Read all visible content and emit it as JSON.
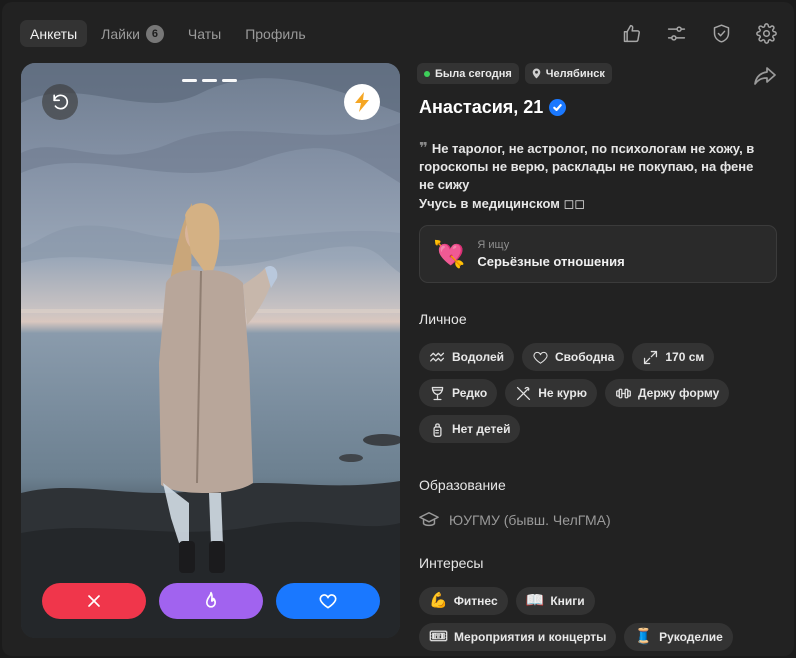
{
  "nav": {
    "tabs": [
      {
        "label": "Анкеты",
        "active": true
      },
      {
        "label": "Лайки",
        "badge": "6"
      },
      {
        "label": "Чаты"
      },
      {
        "label": "Профиль"
      }
    ],
    "icons": [
      "thumbs-up-icon",
      "sliders-icon",
      "shield-check-icon",
      "gear-icon"
    ]
  },
  "photo": {
    "photo_count": 3,
    "active_index": 0
  },
  "profile": {
    "last_seen": "Была сегодня",
    "city": "Челябинск",
    "name": "Анастасия, 21",
    "verified": true,
    "bio_lines": [
      "Не таролог, не астролог, по психологам не хожу, в гороскопы не верю, расклады не покупаю, на фене не сижу",
      "Учусь в медицинском ◻◻"
    ],
    "looking_for": {
      "label": "Я ищу",
      "value": "Серьёзные отношения",
      "icon": "💘"
    }
  },
  "personal": {
    "title": "Личное",
    "tags": [
      "Водолей",
      "Свободна",
      "170 см",
      "Редко",
      "Не курю",
      "Держу форму",
      "Нет детей"
    ]
  },
  "education": {
    "title": "Образование",
    "value": "ЮУГМУ (бывш. ЧелГМА)"
  },
  "interests": {
    "title": "Интересы",
    "tags": [
      {
        "emoji": "💪",
        "label": "Фитнес"
      },
      {
        "emoji": "📖",
        "label": "Книги"
      },
      {
        "emoji": "🎟",
        "label": "Мероприятия и концерты"
      },
      {
        "emoji": "🧵",
        "label": "Рукоделие"
      }
    ]
  },
  "colors": {
    "accent": "#1a78ff",
    "nope": "#f0364b",
    "super": "#a163ef",
    "online": "#3ecf5a"
  }
}
